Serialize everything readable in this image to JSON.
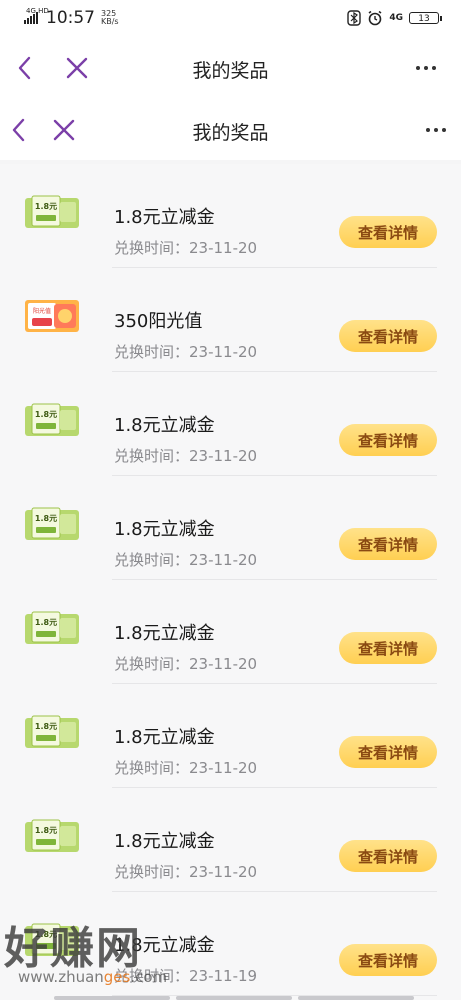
{
  "status_bar": {
    "network_label": "4G HD",
    "time": "10:57",
    "speed_value": "325",
    "speed_unit": "KB/s",
    "network_right": "4G",
    "battery": "13"
  },
  "header": {
    "title": "我的奖品",
    "inner_title": "我的奖品"
  },
  "colors": {
    "accent_purple": "#7b3fa8",
    "button_yellow": "#ffd45c",
    "button_text": "#8a4a12"
  },
  "prizes": [
    {
      "title": "1.8元立减金",
      "date_label": "兑换时间：",
      "date": "23-11-20",
      "icon": "voucher-icon",
      "thumb_text": "1.8元",
      "button": "查看详情"
    },
    {
      "title": "350阳光值",
      "date_label": "兑换时间：",
      "date": "23-11-20",
      "icon": "sunshine-icon",
      "thumb_text": "阳光值",
      "button": "查看详情"
    },
    {
      "title": "1.8元立减金",
      "date_label": "兑换时间：",
      "date": "23-11-20",
      "icon": "voucher-icon",
      "thumb_text": "1.8元",
      "button": "查看详情"
    },
    {
      "title": "1.8元立减金",
      "date_label": "兑换时间：",
      "date": "23-11-20",
      "icon": "voucher-icon",
      "thumb_text": "1.8元",
      "button": "查看详情"
    },
    {
      "title": "1.8元立减金",
      "date_label": "兑换时间：",
      "date": "23-11-20",
      "icon": "voucher-icon",
      "thumb_text": "1.8元",
      "button": "查看详情"
    },
    {
      "title": "1.8元立减金",
      "date_label": "兑换时间：",
      "date": "23-11-20",
      "icon": "voucher-icon",
      "thumb_text": "1.8元",
      "button": "查看详情"
    },
    {
      "title": "1.8元立减金",
      "date_label": "兑换时间：",
      "date": "23-11-20",
      "icon": "voucher-icon",
      "thumb_text": "1.8元",
      "button": "查看详情"
    },
    {
      "title": "1.8元立减金",
      "date_label": "兑换时间：",
      "date": "23-11-19",
      "icon": "voucher-icon",
      "thumb_text": "1.8元",
      "button": "查看详情"
    }
  ],
  "watermark": {
    "text": "好赚网",
    "url_prefix": "www.zhuan",
    "url_highlight": "ges",
    "url_suffix": ".com"
  }
}
